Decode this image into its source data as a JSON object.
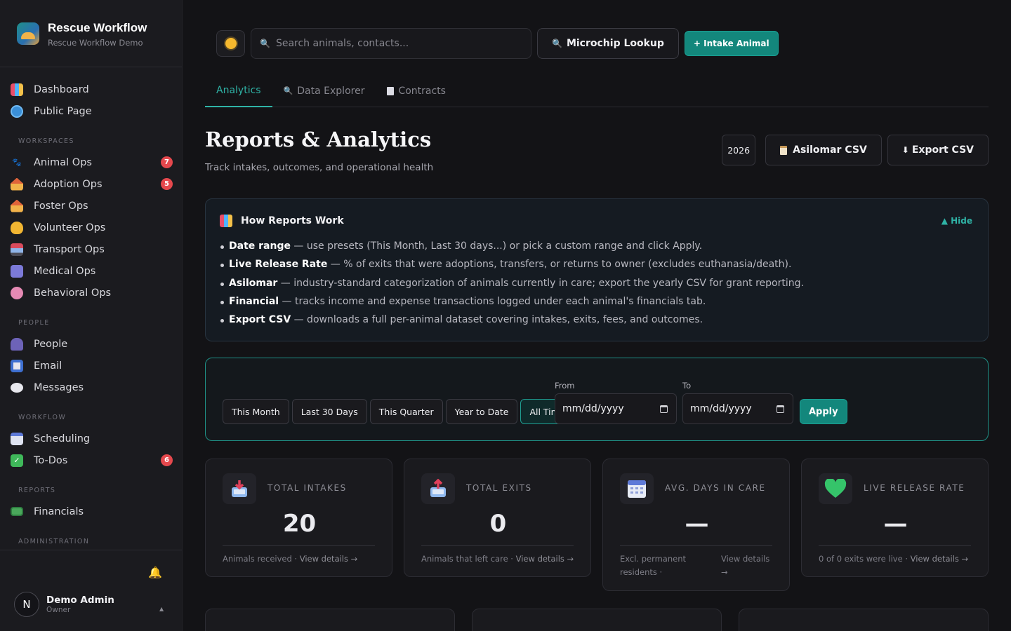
{
  "brand": {
    "title": "Rescue Workflow",
    "subtitle": "Rescue Workflow Demo"
  },
  "sidebar": {
    "top_items": [
      {
        "label": "Dashboard",
        "icon": "bar-chart-icon"
      },
      {
        "label": "Public Page",
        "icon": "globe-icon"
      }
    ],
    "sections": [
      {
        "title": "WORKSPACES",
        "items": [
          {
            "label": "Animal Ops",
            "icon": "paw-icon",
            "badge": "7"
          },
          {
            "label": "Adoption Ops",
            "icon": "house-icon",
            "badge": "5"
          },
          {
            "label": "Foster Ops",
            "icon": "house-icon",
            "badge": ""
          },
          {
            "label": "Volunteer Ops",
            "icon": "heart-hands-icon",
            "badge": ""
          },
          {
            "label": "Transport Ops",
            "icon": "van-icon",
            "badge": ""
          },
          {
            "label": "Medical Ops",
            "icon": "medical-icon",
            "badge": ""
          },
          {
            "label": "Behavioral Ops",
            "icon": "brain-icon",
            "badge": ""
          }
        ]
      },
      {
        "title": "PEOPLE",
        "items": [
          {
            "label": "People",
            "icon": "people-icon",
            "badge": ""
          },
          {
            "label": "Email",
            "icon": "email-icon",
            "badge": ""
          },
          {
            "label": "Messages",
            "icon": "chat-bubble-icon",
            "badge": ""
          }
        ]
      },
      {
        "title": "WORKFLOW",
        "items": [
          {
            "label": "Scheduling",
            "icon": "calendar-icon",
            "badge": ""
          },
          {
            "label": "To-Dos",
            "icon": "checkbox-icon",
            "badge": "6"
          }
        ]
      },
      {
        "title": "REPORTS",
        "items": [
          {
            "label": "Financials",
            "icon": "money-icon",
            "badge": ""
          }
        ]
      },
      {
        "title": "ADMINISTRATION",
        "items": []
      }
    ],
    "user": {
      "initial": "N",
      "name": "Demo Admin",
      "role": "Owner"
    }
  },
  "topbar": {
    "search_placeholder": "Search animals, contacts...",
    "microchip_label": "Microchip Lookup",
    "intake_label": "+ Intake Animal"
  },
  "tabs": [
    {
      "label": "Analytics",
      "icon": ""
    },
    {
      "label": "Data Explorer",
      "icon": "search-icon"
    },
    {
      "label": "Contracts",
      "icon": "document-icon"
    }
  ],
  "header": {
    "title": "Reports & Analytics",
    "subtitle": "Track intakes, outcomes, and operational health",
    "year": "2026",
    "asilomar_label": "Asilomar CSV",
    "export_label": "Export CSV"
  },
  "info": {
    "title": "How Reports Work",
    "hide_label": "▲ Hide",
    "items": [
      {
        "term": "Date range",
        "text": " — use presets (This Month, Last 30 days...) or pick a custom range and click Apply."
      },
      {
        "term": "Live Release Rate",
        "text": " — % of exits that were adoptions, transfers, or returns to owner (excludes euthanasia/death)."
      },
      {
        "term": "Asilomar",
        "text": " — industry-standard categorization of animals currently in care; export the yearly CSV for grant reporting."
      },
      {
        "term": "Financial",
        "text": " — tracks income and expense transactions logged under each animal's financials tab."
      },
      {
        "term": "Export CSV",
        "text": " — downloads a full per-animal dataset covering intakes, exits, fees, and outcomes."
      }
    ]
  },
  "range": {
    "presets": [
      "This Month",
      "Last 30 Days",
      "This Quarter",
      "Year to Date",
      "All Time"
    ],
    "active_preset": "All Time",
    "from_label": "From",
    "to_label": "To",
    "from_value": "mm/dd/yyyy",
    "to_value": "mm/dd/yyyy",
    "apply_label": "Apply"
  },
  "stats": [
    {
      "label": "TOTAL INTAKES",
      "value": "20",
      "foot": "Animals received · ",
      "link": "View details →",
      "icon": "inbox-in-icon"
    },
    {
      "label": "TOTAL EXITS",
      "value": "0",
      "foot": "Animals that left care · ",
      "link": "View details →",
      "icon": "inbox-out-icon"
    },
    {
      "label": "AVG. DAYS IN CARE",
      "value": "—",
      "foot": "Excl. permanent residents · ",
      "link": "View details →",
      "icon": "calendar-icon"
    },
    {
      "label": "LIVE RELEASE RATE",
      "value": "—",
      "foot": "0 of 0 exits were live · ",
      "link": "View details →",
      "icon": "green-heart-icon"
    }
  ],
  "colors": {
    "accent": "#2fb3a6",
    "badge": "#e5484d",
    "background": "#131316",
    "sidebar": "#1b1b1f"
  }
}
